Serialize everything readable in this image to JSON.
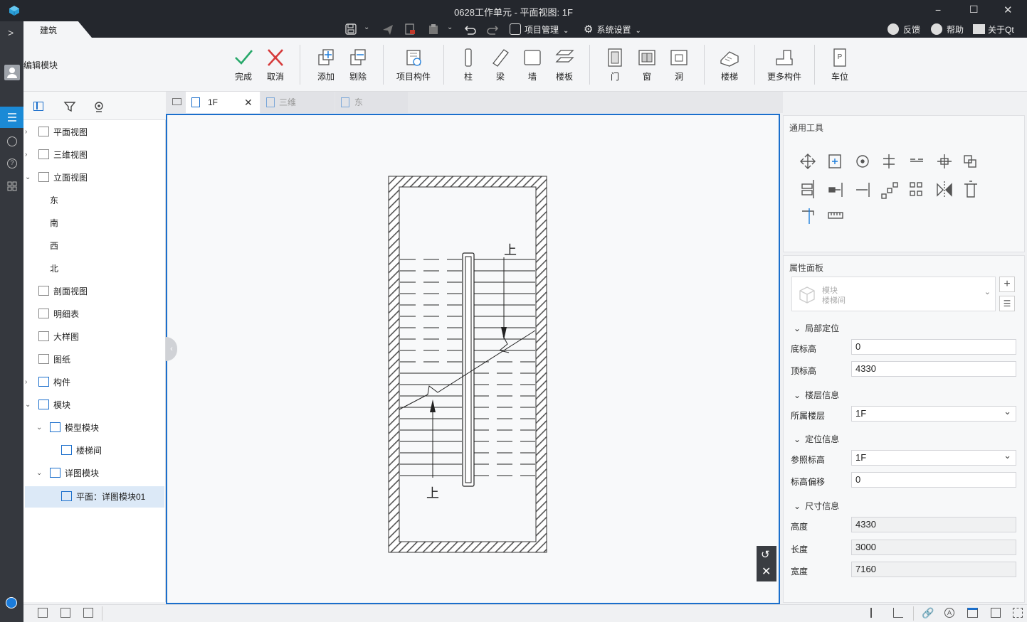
{
  "window": {
    "title": "0628工作单元 - 平面视图: 1F",
    "minimize": "−",
    "maximize": "☐",
    "close": "✕"
  },
  "menu": {
    "tab_active": "建筑",
    "project_manage": "项目管理",
    "system_settings": "系统设置",
    "feedback": "反馈",
    "help": "帮助",
    "about": "关于Qt"
  },
  "mode_label": "编辑模块",
  "ribbon": {
    "finish": "完成",
    "cancel": "取消",
    "add": "添加",
    "remove": "剔除",
    "project_component": "项目构件",
    "column": "柱",
    "beam": "梁",
    "wall": "墙",
    "slab": "楼板",
    "door": "门",
    "window": "窗",
    "opening": "洞",
    "stair": "楼梯",
    "more_components": "更多构件",
    "parking": "车位"
  },
  "tree": {
    "items": [
      {
        "label": "平面视图"
      },
      {
        "label": "三维视图"
      },
      {
        "label": "立面视图"
      },
      {
        "label": "东"
      },
      {
        "label": "南"
      },
      {
        "label": "西"
      },
      {
        "label": "北"
      },
      {
        "label": "剖面视图"
      },
      {
        "label": "明细表"
      },
      {
        "label": "大样图"
      },
      {
        "label": "图纸"
      },
      {
        "label": "构件"
      },
      {
        "label": "模块"
      },
      {
        "label": "模型模块"
      },
      {
        "label": "楼梯间"
      },
      {
        "label": "详图模块"
      },
      {
        "label": "平面：详图模块01"
      }
    ]
  },
  "view_tabs": [
    {
      "label": "1F"
    },
    {
      "label": "三维"
    },
    {
      "label": "东"
    }
  ],
  "general_tools": {
    "title": "通用工具"
  },
  "properties": {
    "title": "属性面板",
    "type_category": "模块",
    "type_name": "楼梯间",
    "sections": {
      "local": "局部定位",
      "floor": "楼层信息",
      "position": "定位信息",
      "size": "尺寸信息"
    },
    "base_elev_label": "底标高",
    "base_elev": "0",
    "top_elev_label": "顶标高",
    "top_elev": "4330",
    "floor_label": "所属楼层",
    "floor": "1F",
    "ref_elev_label": "参照标高",
    "ref_elev": "1F",
    "elev_offset_label": "标高偏移",
    "elev_offset": "0",
    "height_label": "高度",
    "height": "4330",
    "length_label": "长度",
    "length": "3000",
    "width_label": "宽度",
    "width": "7160"
  },
  "drawing": {
    "up_label": "上"
  }
}
